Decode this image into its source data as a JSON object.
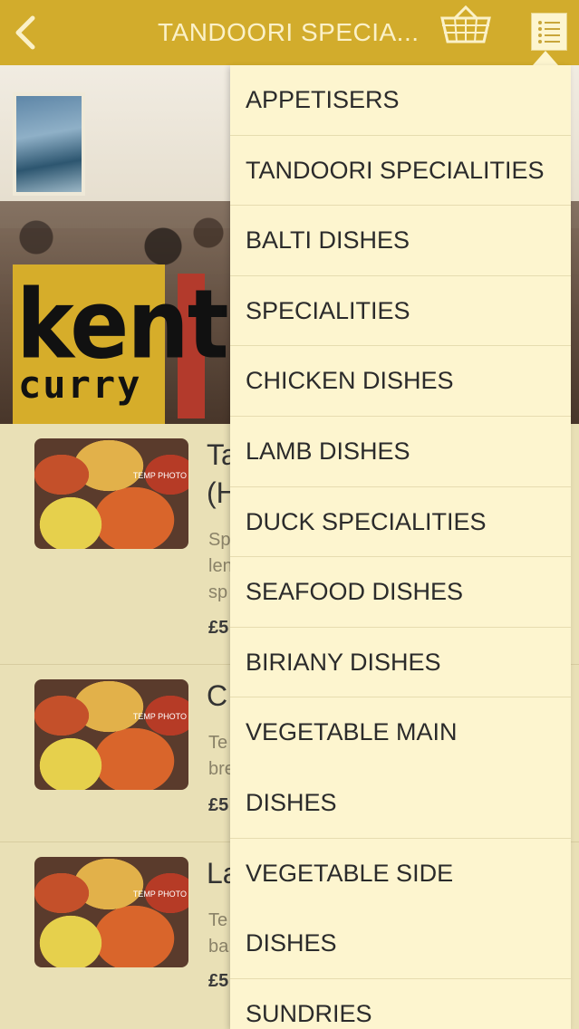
{
  "header": {
    "title": "TANDOORI SPECIA...",
    "back_icon": "chevron-left-icon",
    "basket_icon": "basket-icon",
    "menu_icon": "list-menu-icon",
    "bar_color": "#d2ac2c"
  },
  "logo": {
    "line1": "kent",
    "line2": "curry",
    "color": "#d6ad2a"
  },
  "products": [
    {
      "title": "Ta",
      "title_line2": "(H",
      "desc": [
        "Sp",
        "len",
        "sp"
      ],
      "price": "£5",
      "badge": "TEMP PHOTO"
    },
    {
      "title": "C",
      "desc": [
        "Te",
        "bre"
      ],
      "price": "£5",
      "badge": "TEMP PHOTO"
    },
    {
      "title": "La",
      "desc": [
        "Te",
        "ba"
      ],
      "price": "£5",
      "badge": "TEMP PHOTO"
    }
  ],
  "menu": {
    "items": [
      "APPETISERS",
      "TANDOORI SPECIALITIES",
      "BALTI DISHES",
      "SPECIALITIES",
      "CHICKEN DISHES",
      "LAMB DISHES",
      "DUCK SPECIALITIES",
      "SEAFOOD DISHES",
      "BIRIANY DISHES",
      "VEGETABLE MAIN",
      "DISHES",
      "VEGETABLE SIDE",
      "DISHES",
      "SUNDRIES"
    ]
  }
}
